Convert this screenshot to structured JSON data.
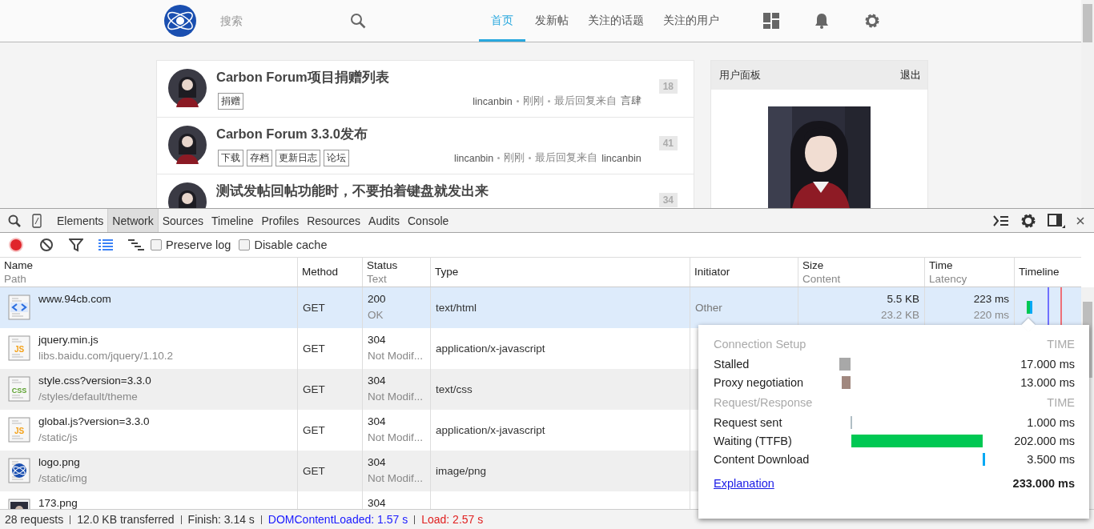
{
  "site": {
    "search": {
      "placeholder": "搜索"
    },
    "nav": [
      {
        "label": "首页",
        "selected": true
      },
      {
        "label": "发新帖",
        "selected": false
      },
      {
        "label": "关注的话题",
        "selected": false
      },
      {
        "label": "关注的用户",
        "selected": false
      }
    ],
    "topics": [
      {
        "title": "Carbon Forum项目捐赠列表",
        "tags": [
          "捐赠"
        ],
        "author": "lincanbin",
        "time": "刚刚",
        "last_reply_label": "最后回复来自",
        "last_reply_user": "言肆",
        "replies": "18"
      },
      {
        "title": "Carbon Forum 3.3.0发布",
        "tags": [
          "下载",
          "存档",
          "更新日志",
          "论坛"
        ],
        "author": "lincanbin",
        "time": "刚刚",
        "last_reply_label": "最后回复来自",
        "last_reply_user": "lincanbin",
        "replies": "41"
      },
      {
        "title": "测试发帖回帖功能时，不要拍着键盘就发出来",
        "replies": "34"
      }
    ],
    "user_panel": {
      "title": "用户面板",
      "logout": "退出"
    }
  },
  "devtools": {
    "tabs": [
      {
        "label": "Elements",
        "selected": false
      },
      {
        "label": "Network",
        "selected": true
      },
      {
        "label": "Sources",
        "selected": false
      },
      {
        "label": "Timeline",
        "selected": false
      },
      {
        "label": "Profiles",
        "selected": false
      },
      {
        "label": "Resources",
        "selected": false
      },
      {
        "label": "Audits",
        "selected": false
      },
      {
        "label": "Console",
        "selected": false
      }
    ],
    "recording": true,
    "checkboxes": [
      {
        "label": "Preserve log",
        "checked": false
      },
      {
        "label": "Disable cache",
        "checked": false
      }
    ],
    "columns": [
      {
        "label": "Name",
        "sub": "Path"
      },
      {
        "label": "Method"
      },
      {
        "label": "Status",
        "sub": "Text"
      },
      {
        "label": "Type"
      },
      {
        "label": "Initiator"
      },
      {
        "label": "Size",
        "sub": "Content"
      },
      {
        "label": "Time",
        "sub": "Latency"
      },
      {
        "label": "Timeline"
      }
    ],
    "rows": [
      {
        "kind": "html",
        "name": "www.94cb.com",
        "method": "GET",
        "status": "200",
        "status_text": "OK",
        "type": "text/html",
        "initiator": "Other",
        "size": "5.5 KB",
        "content": "23.2 KB",
        "time": "223 ms",
        "latency": "220 ms",
        "selected": true
      },
      {
        "kind": "js",
        "icon_label": "JS",
        "name": "jquery.min.js",
        "path": "libs.baidu.com/jquery/1.10.2",
        "method": "GET",
        "status": "304",
        "status_text": "Not Modif...",
        "type": "application/x-javascript",
        "selected": false
      },
      {
        "kind": "css",
        "icon_label": "CSS",
        "name": "style.css?version=3.3.0",
        "path": "/styles/default/theme",
        "method": "GET",
        "status": "304",
        "status_text": "Not Modif...",
        "type": "text/css",
        "selected": false
      },
      {
        "kind": "js",
        "icon_label": "JS",
        "name": "global.js?version=3.3.0",
        "path": "/static/js",
        "method": "GET",
        "status": "304",
        "status_text": "Not Modif...",
        "type": "application/x-javascript",
        "selected": false
      },
      {
        "kind": "logo",
        "name": "logo.png",
        "path": "/static/img",
        "method": "GET",
        "status": "304",
        "status_text": "Not Modif...",
        "type": "image/png",
        "selected": false
      },
      {
        "name": "173.png",
        "status": "304",
        "selected": false
      }
    ],
    "status_bar": [
      {
        "kind": "plain",
        "text": "28 requests"
      },
      {
        "kind": "plain",
        "text": "12.0 KB transferred"
      },
      {
        "kind": "plain",
        "text": "Finish: 3.14 s"
      },
      {
        "kind": "dom",
        "text": "DOMContentLoaded: 1.57 s"
      },
      {
        "kind": "load",
        "text": "Load: 2.57 s"
      }
    ],
    "timing_popover": {
      "sections": [
        {
          "kind": "setup",
          "title": "Connection Setup",
          "time_label": "TIME",
          "items": [
            {
              "label": "Stalled",
              "value": "17.000 ms",
              "color": "#a8a8a8"
            },
            {
              "label": "Proxy negotiation",
              "value": "13.000 ms",
              "color": "#a1887f"
            }
          ]
        },
        {
          "kind": "request",
          "title": "Request/Response",
          "time_label": "TIME",
          "items": [
            {
              "label": "Request sent",
              "value": "1.000 ms",
              "color": "#b0bec5"
            },
            {
              "label": "Waiting (TTFB)",
              "value": "202.000 ms",
              "color": "#00c853"
            },
            {
              "label": "Content Download",
              "value": "3.500 ms",
              "color": "#03a9f4"
            }
          ]
        }
      ],
      "link": "Explanation",
      "total": "233.000 ms"
    }
  }
}
